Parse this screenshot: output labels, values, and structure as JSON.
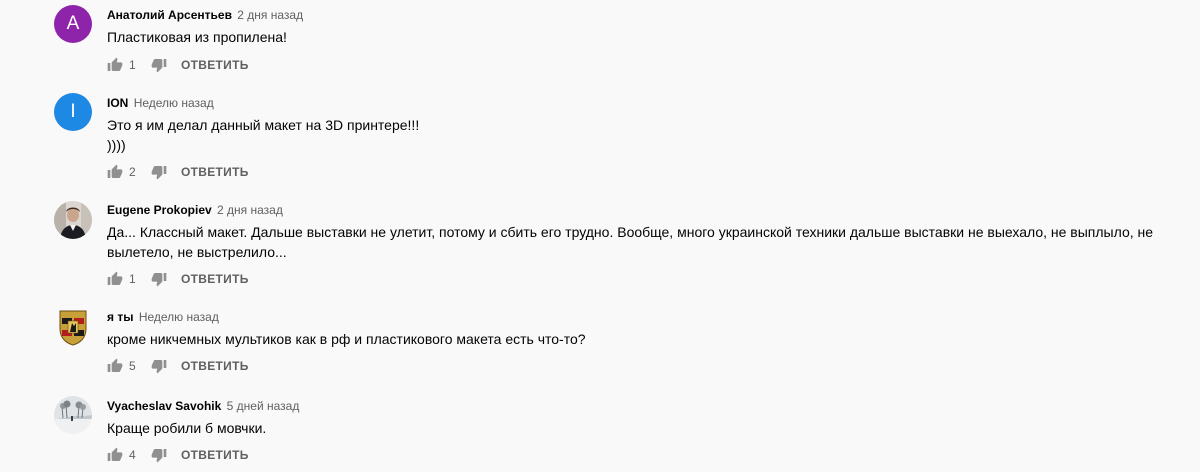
{
  "comments": [
    {
      "author": "Анатолий Арсентьев",
      "time": "2 дня назад",
      "text": "Пластиковая из пропилена!",
      "likes": "1",
      "reply_label": "ОТВЕТИТЬ",
      "avatar_letter": "А",
      "avatar_color": "#8e24aa"
    },
    {
      "author": "ION",
      "time": "Неделю назад",
      "text": "Это я им делал данный макет на 3D принтере!!!\n))))",
      "likes": "2",
      "reply_label": "ОТВЕТИТЬ",
      "avatar_letter": "I",
      "avatar_color": "#1e88e5"
    },
    {
      "author": "Eugene Prokopiev",
      "time": "2 дня назад",
      "text": "Да... Классный макет. Дальше выставки не улетит, потому и сбить его трудно. Вообще, много украинской техники дальше выставки не выехало, не выплыло, не вылетело, не выстрелило...",
      "likes": "1",
      "reply_label": "ОТВЕТИТЬ",
      "avatar_kind": "photo-person"
    },
    {
      "author": "я ты",
      "time": "Неделю назад",
      "text": "кроме никчемных мультиков как в рф и пластикового макета есть что-то?",
      "likes": "5",
      "reply_label": "ОТВЕТИТЬ",
      "avatar_kind": "porsche-crest"
    },
    {
      "author": "Vyacheslav Savohik",
      "time": "5 дней назад",
      "text": "Краще робили б мовчки.",
      "likes": "4",
      "reply_label": "ОТВЕТИТЬ",
      "avatar_kind": "photo-landscape"
    }
  ]
}
